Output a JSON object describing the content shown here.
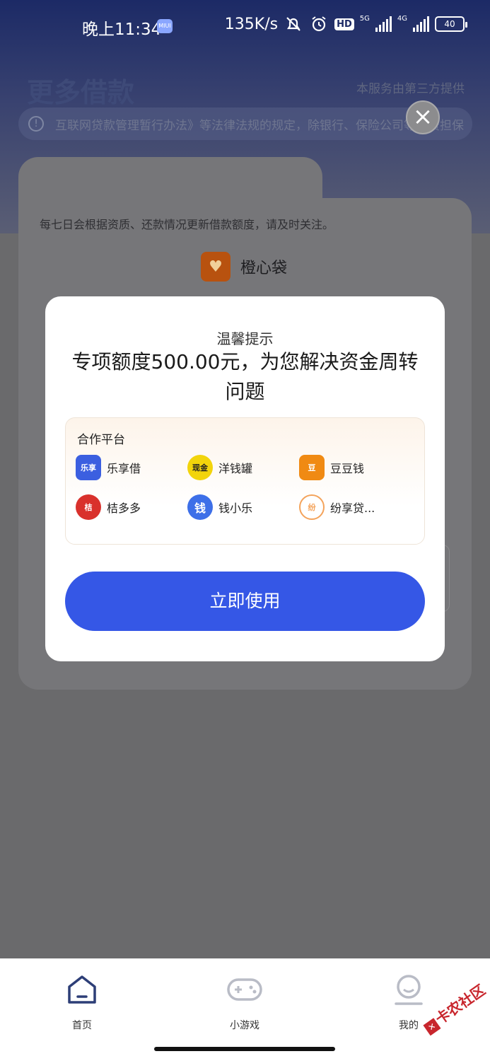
{
  "status_bar": {
    "time": "晚上11:34",
    "miui_badge": "MIUI",
    "speed": "135K/s",
    "hd_label": "HD",
    "net1": "5G",
    "net2": "4G",
    "battery": "40"
  },
  "header": {
    "title": "更多借款",
    "provider_note": "本服务由第三方提供",
    "notice_text": "互联网贷款管理暂行办法》等法律法规的规定，除银行、保险公司等融资担保"
  },
  "card": {
    "note": "每七日会根据资质、还款情况更新借款额度，请及时关注。",
    "brand_name": "橙心袋"
  },
  "modal": {
    "subtitle": "温馨提示",
    "title": "专项额度500.00元，为您解决资金周转问题",
    "partners_title": "合作平台",
    "partners": [
      {
        "name": "乐享借",
        "logo_text": "乐享",
        "color": "#3b5fe0",
        "icon": "lexiangjie-logo"
      },
      {
        "name": "洋钱罐",
        "logo_text": "现金",
        "color": "#f2d40b",
        "icon": "yangqianguan-logo"
      },
      {
        "name": "豆豆钱",
        "logo_text": "豆",
        "color": "#f08a13",
        "icon": "doudouqian-logo"
      },
      {
        "name": "桔多多",
        "logo_text": "桔",
        "color": "#d9312c",
        "icon": "juduoduo-logo"
      },
      {
        "name": "钱小乐",
        "logo_text": "钱",
        "color": "#3d6fe8",
        "icon": "qianxiaole-logo"
      },
      {
        "name": "纷享贷...",
        "logo_text": "纷",
        "color": "#f4a35b",
        "icon": "fenxiangdai-logo"
      }
    ],
    "button_label": "立即使用",
    "close_icon": "close-icon"
  },
  "bottom_nav": {
    "items": [
      {
        "label": "首页",
        "icon": "home-icon"
      },
      {
        "label": "小游戏",
        "icon": "gamepad-icon"
      },
      {
        "label": "我的",
        "icon": "profile-icon"
      }
    ]
  },
  "watermark": "卡农社区"
}
